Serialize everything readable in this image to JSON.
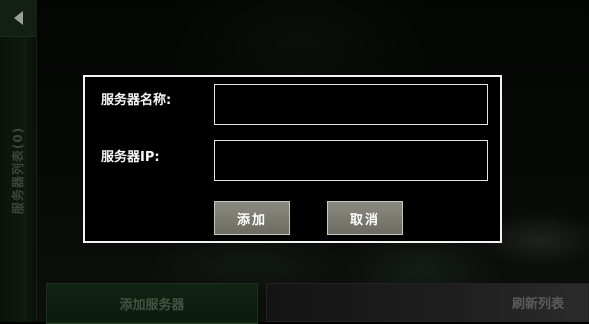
{
  "sidebar": {
    "tab_label": "服务器列表(0)"
  },
  "bottom_bar": {
    "add_server_label": "添加服务器",
    "refresh_label": "刷新列表"
  },
  "dialog": {
    "name_label": "服务器名称:",
    "ip_label": "服务器IP:",
    "name_value": "",
    "ip_value": "",
    "add_label": "添加",
    "cancel_label": "取消"
  }
}
